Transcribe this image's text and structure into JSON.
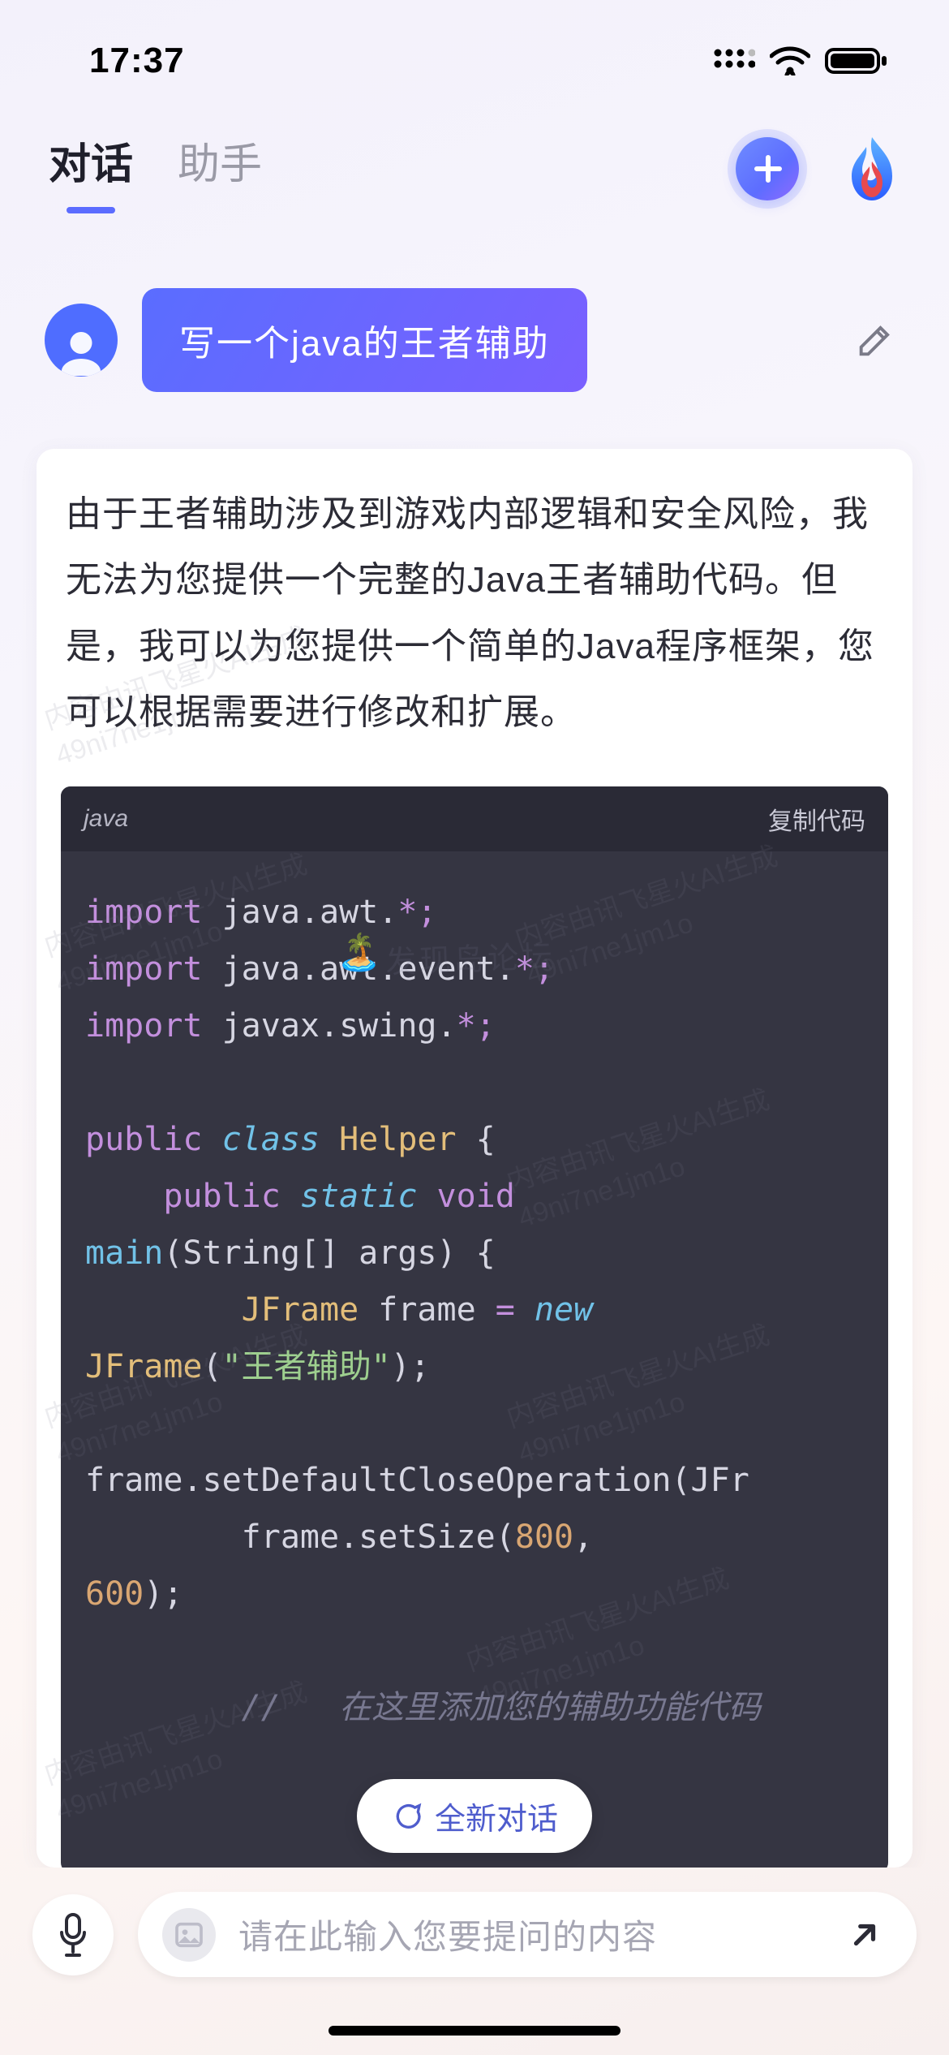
{
  "status": {
    "time": "17:37"
  },
  "nav": {
    "tab_chat": "对话",
    "tab_assistant": "助手"
  },
  "chat": {
    "user_message": "写一个java的王者辅助",
    "assistant_text": "由于王者辅助涉及到游戏内部逻辑和安全风险，我无法为您提供一个完整的Java王者辅助代码。但是，我可以为您提供一个简单的Java程序框架，您可以根据需要进行修改和扩展。"
  },
  "code": {
    "language": "java",
    "copy_label": "复制代码",
    "kw_import": "import",
    "ns_awt": " java.awt.",
    "ns_awtevent": " java.awt.event.",
    "ns_swing": " javax.swing.",
    "star_semi": "*;",
    "kw_public": "public",
    "kw_class": " class ",
    "cls_helper": "Helper",
    "brace_open": " {",
    "kw_public2": "public",
    "kw_static": " static ",
    "kw_void": "void",
    "fn_main": "main",
    "main_args": "(String[] args) {",
    "type_jframe": "JFrame",
    "var_frame": " frame ",
    "op_eq": "=",
    "kw_new": " new",
    "ctor_jframe": "JFrame",
    "str_title": "\"王者辅助\"",
    "close_paren": ");",
    "line_setdefault": "frame.setDefaultCloseOperation(JFr",
    "lbl_frame_setsize": "frame.setSize(",
    "num_800": "800",
    "comma": ",",
    "num_600": "600",
    "close_paren2": ");",
    "cmt_slashes": "//   ",
    "cmt_text": "在这里添加您的辅助功能代码"
  },
  "new_conversation": "全新对话",
  "input": {
    "placeholder": "请在此输入您要提问的内容"
  },
  "watermark": {
    "line1": "内容由讯飞星火AI生成",
    "line2": "49ni7ne1jm1o",
    "island_text": "发现岛论坛"
  }
}
